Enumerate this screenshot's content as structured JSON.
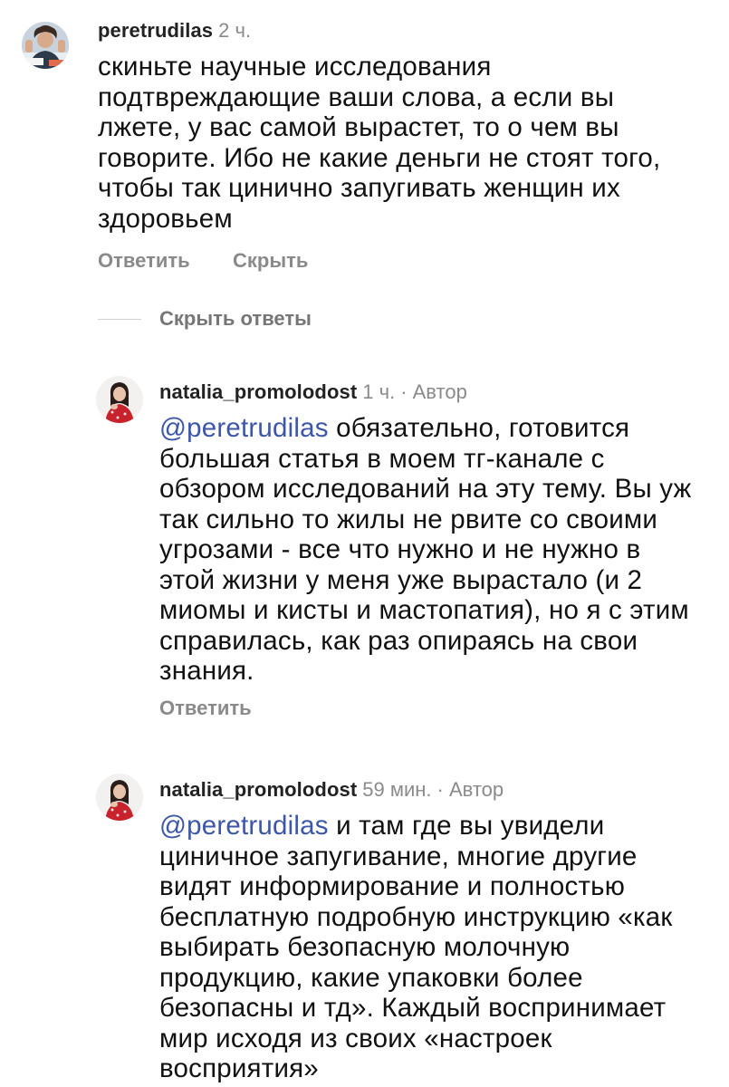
{
  "comments": [
    {
      "username": "peretrudilas",
      "time": "2 ч.",
      "author_tag": "",
      "mention": "",
      "text": "скиньте научные исследования подтвреждающие ваши слова, а если вы лжете, у вас самой вырастет, то о чем вы говорите. Ибо не какие деньги не стоят того, чтобы так цинично запугивать женщин их здоровьем",
      "reply_label": "Ответить",
      "hide_label": "Скрыть"
    },
    {
      "username": "natalia_promolodost",
      "time": "1 ч.",
      "author_tag": "· Автор",
      "mention": "@peretrudilas",
      "text": " обязательно, готовится большая статья в моем тг-канале с обзором исследований на эту тему. Вы уж так сильно то жилы не рвите со своими угрозами - все что нужно и не нужно в этой жизни у меня уже вырастало (и 2 миомы и кисты и мастопатия), но я с этим справилась, как раз опираясь на свои знания.",
      "reply_label": "Ответить"
    },
    {
      "username": "natalia_promolodost",
      "time": "59 мин.",
      "author_tag": "· Автор",
      "mention": "@peretrudilas",
      "text": " и там где вы увидели циничное запугивание, многие другие видят информирование и полностью бесплатную подробную инструкцию «как выбирать безопасную молочную продукцию, какие упаковки более безопасны и тд». Каждый воспринимает мир исходя из своих «настроек восприятия»"
    }
  ],
  "hide_replies_label": "Скрыть ответы",
  "colors": {
    "mention": "#3c56a8",
    "meta": "#8a8a8a",
    "text": "#111111"
  },
  "icons": {
    "avatar_1": "user-avatar-photo",
    "avatar_2": "author-avatar-photo"
  }
}
